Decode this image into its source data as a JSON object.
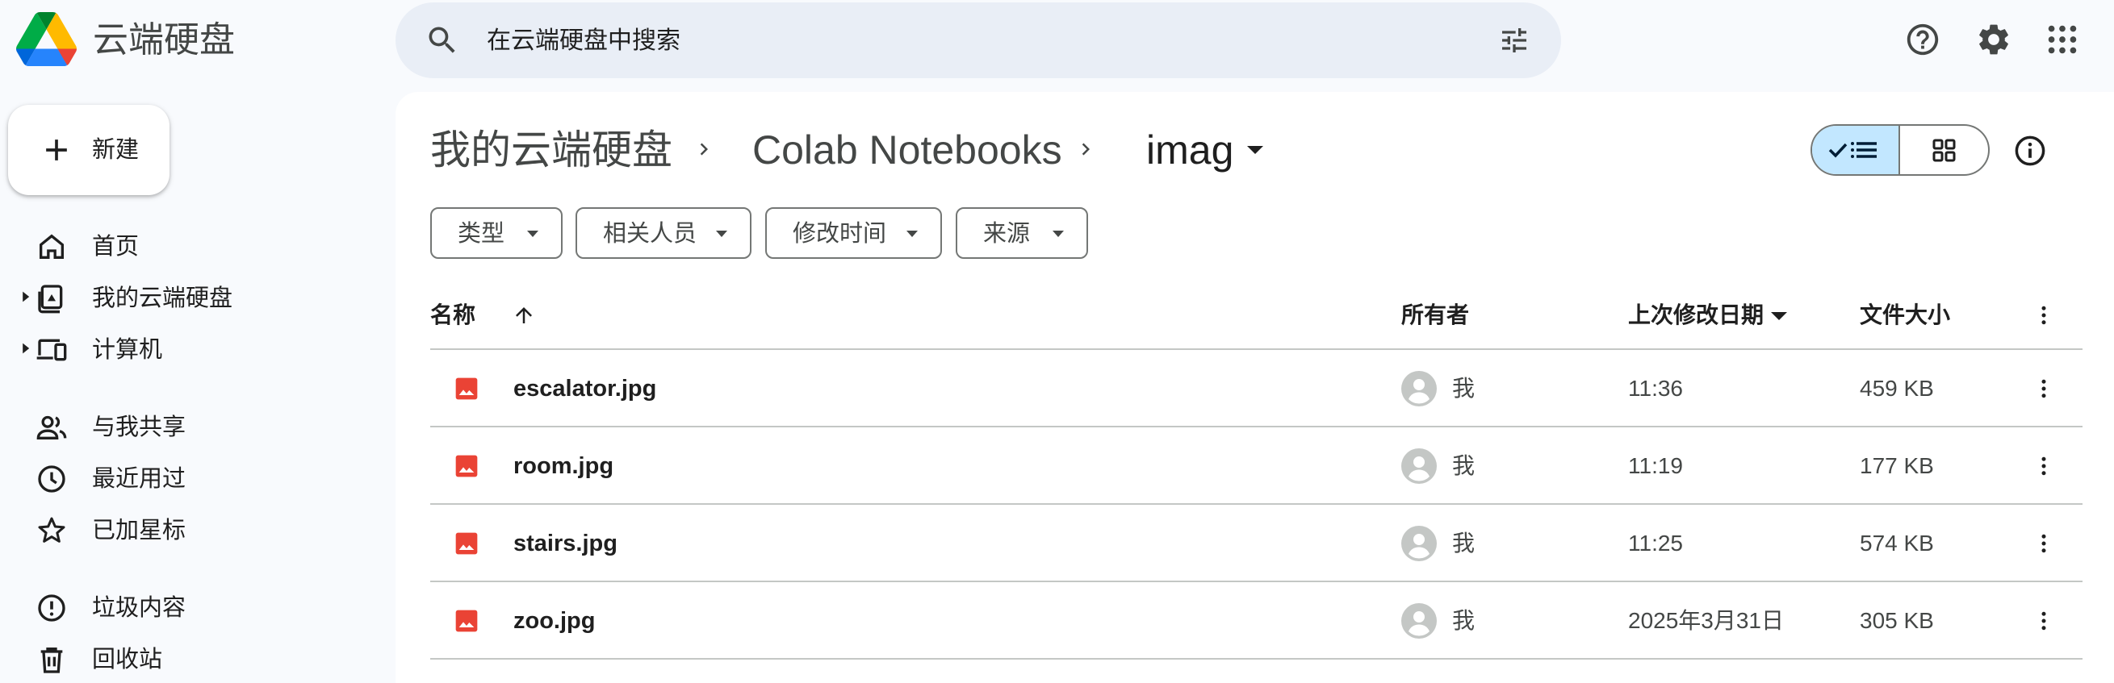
{
  "app": {
    "name": "云端硬盘"
  },
  "search": {
    "placeholder": "在云端硬盘中搜索"
  },
  "sidebar": {
    "new_label": "新建",
    "items": [
      {
        "label": "首页",
        "icon": "home-icon"
      },
      {
        "label": "我的云端硬盘",
        "icon": "drive-icon"
      },
      {
        "label": "计算机",
        "icon": "computer-icon"
      },
      {
        "label": "与我共享",
        "icon": "people-icon"
      },
      {
        "label": "最近用过",
        "icon": "clock-icon"
      },
      {
        "label": "已加星标",
        "icon": "star-icon"
      },
      {
        "label": "垃圾内容",
        "icon": "spam-icon"
      },
      {
        "label": "回收站",
        "icon": "trash-icon"
      }
    ]
  },
  "breadcrumb": [
    "我的云端硬盘",
    "Colab Notebooks",
    "imag"
  ],
  "filters": [
    "类型",
    "相关人员",
    "修改时间",
    "来源"
  ],
  "table": {
    "headers": {
      "name": "名称",
      "owner": "所有者",
      "modified": "上次修改日期",
      "size": "文件大小"
    },
    "rows": [
      {
        "name": "escalator.jpg",
        "owner": "我",
        "modified": "11:36",
        "size": "459 KB"
      },
      {
        "name": "room.jpg",
        "owner": "我",
        "modified": "11:19",
        "size": "177 KB"
      },
      {
        "name": "stairs.jpg",
        "owner": "我",
        "modified": "11:25",
        "size": "574 KB"
      },
      {
        "name": "zoo.jpg",
        "owner": "我",
        "modified": "2025年3月31日",
        "size": "305 KB"
      }
    ]
  },
  "colors": {
    "accent_selected": "#c2e7ff",
    "image_file": "#ea4335",
    "search_bg": "#e9eef6"
  }
}
